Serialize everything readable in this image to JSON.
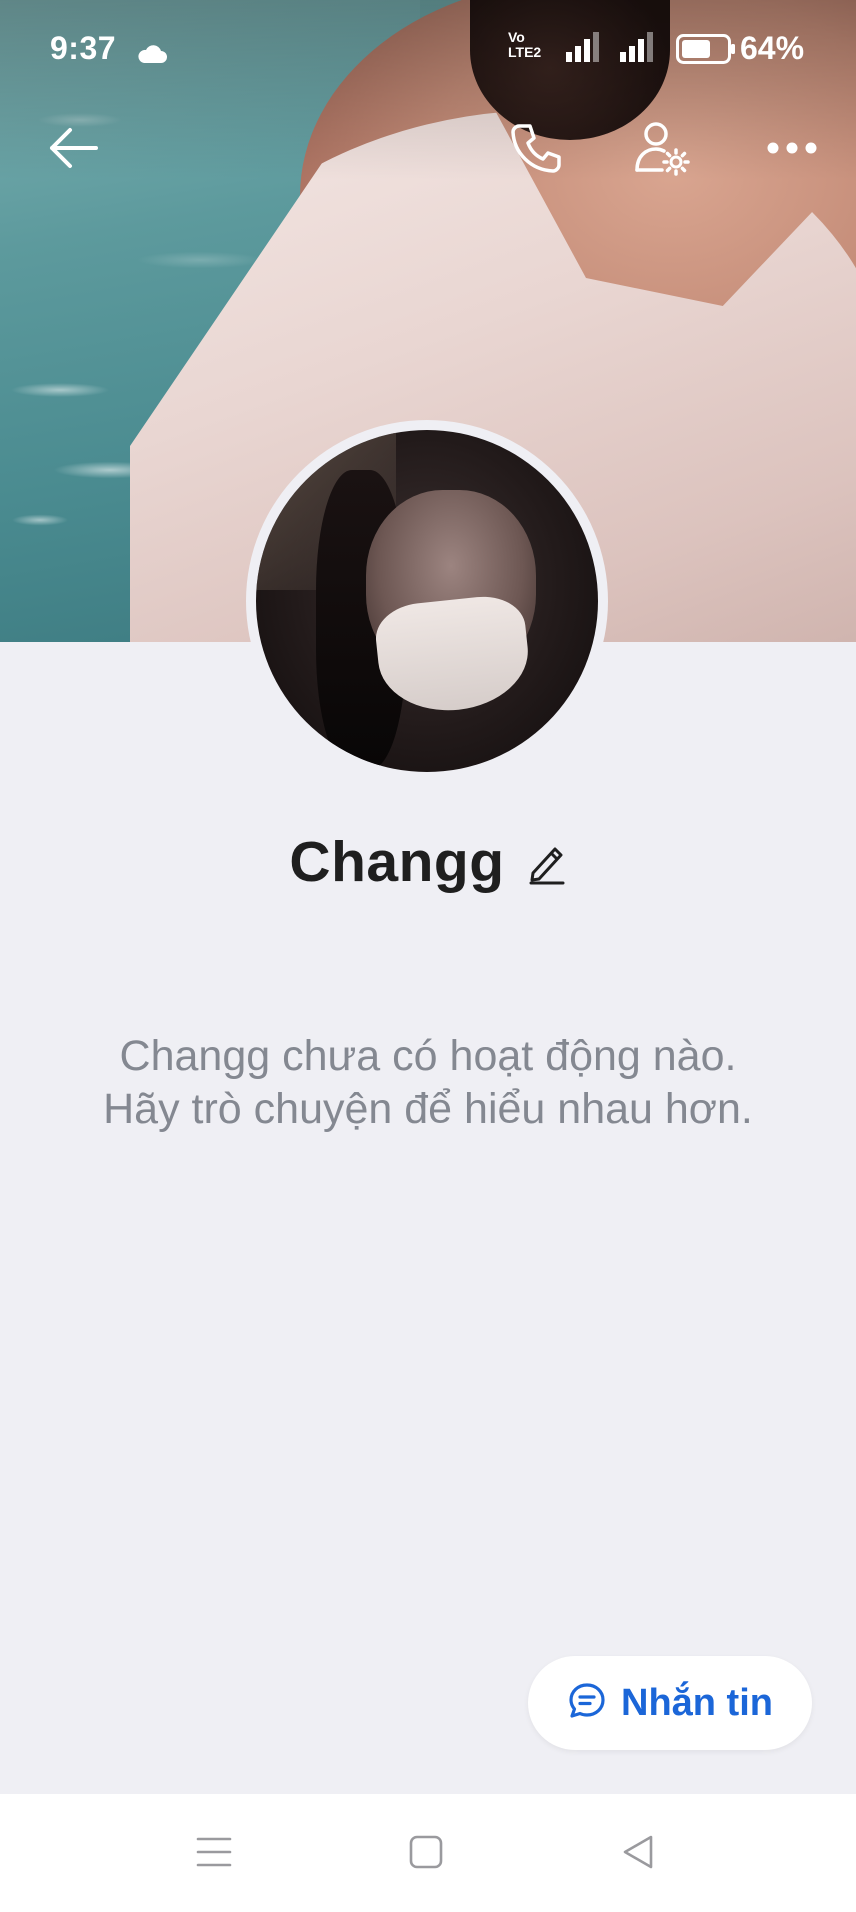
{
  "status_bar": {
    "time": "9:37",
    "network_label_top": "Vo",
    "network_label_bottom": "LTE2",
    "battery_percent": "64%",
    "battery_level": 0.64
  },
  "profile": {
    "name": "Changg",
    "empty_message": "Changg chưa có hoạt động nào. Hãy trò chuyện để hiểu nhau hơn."
  },
  "actions": {
    "message_label": "Nhắn tin"
  },
  "icons": {
    "back": "arrow-left-icon",
    "call": "phone-icon",
    "settings": "user-settings-icon",
    "more": "more-dots-icon",
    "edit": "pencil-icon",
    "message": "chat-bubble-icon"
  },
  "colors": {
    "accent": "#1b66d8",
    "background": "#efeff4",
    "name_text": "#1f1f1f",
    "muted_text": "#848891"
  }
}
